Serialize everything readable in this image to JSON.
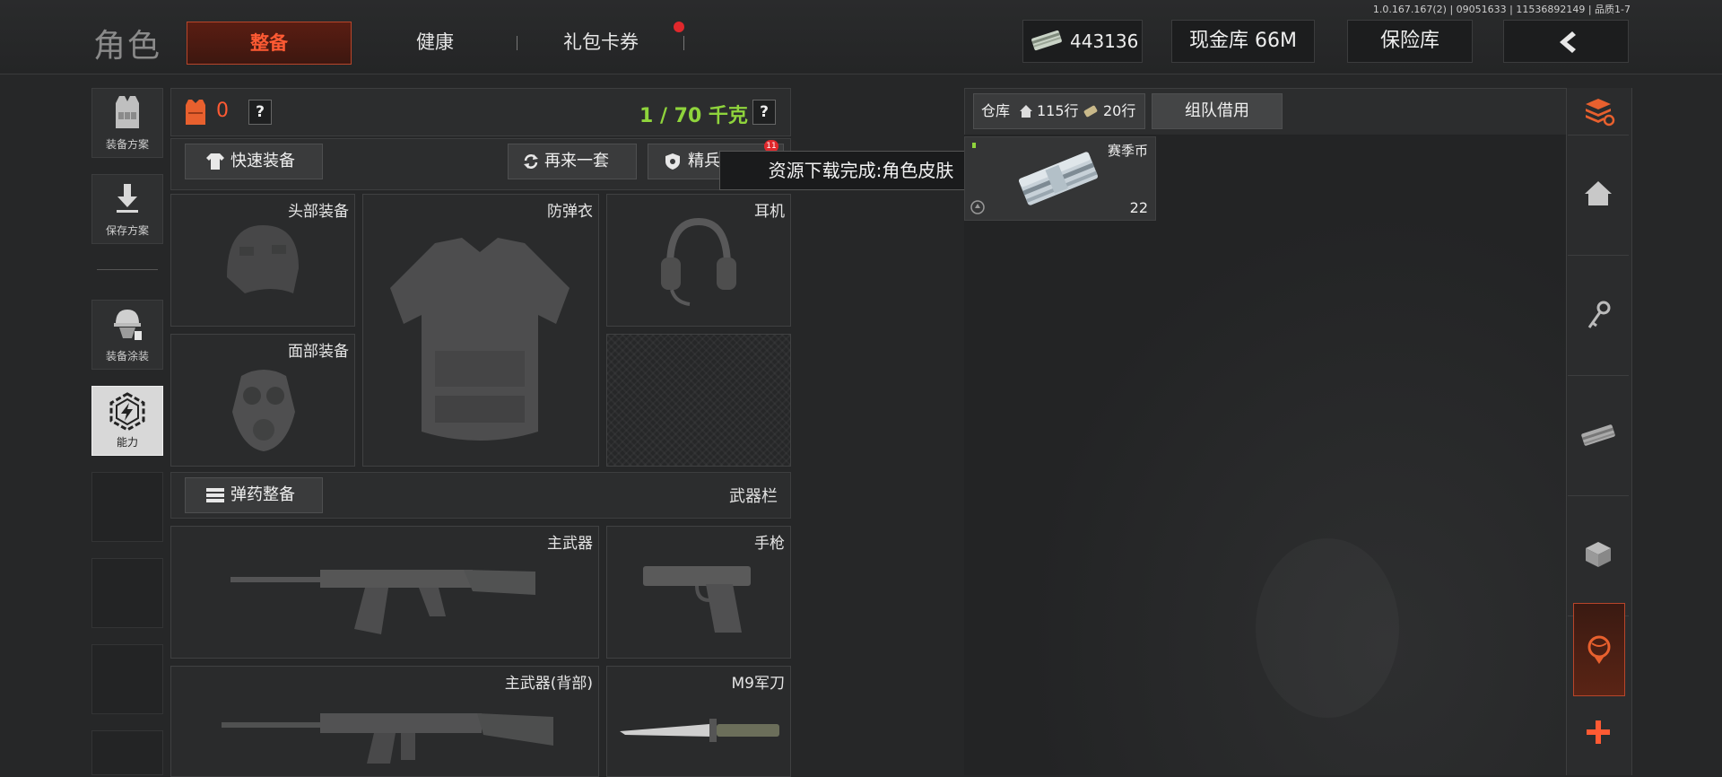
{
  "version": "1.0.167.167(2) | 09051633 | 11536892149 | 品质1-7",
  "header": {
    "title": "角色",
    "tabs": [
      {
        "label": "整备",
        "active": true
      },
      {
        "label": "健康",
        "active": false
      },
      {
        "label": "礼包卡券",
        "active": false,
        "badge": true
      }
    ],
    "currency_value": "443136",
    "cash_storage": "现金库 66M",
    "vault": "保险库"
  },
  "left_nav": {
    "items": [
      {
        "label": "装备方案",
        "icon": "vest-icon"
      },
      {
        "label": "保存方案",
        "icon": "download-icon"
      },
      {
        "label": "装备涂装",
        "icon": "paint-helmet-icon"
      },
      {
        "label": "能力",
        "icon": "ability-hex-icon",
        "selected": true
      }
    ]
  },
  "loadout": {
    "armor_count": "0",
    "help": "?",
    "weight": "1 / 70 千克",
    "quick_equip": "快速装备",
    "repeat_set": "再来一套",
    "elite": "精兵",
    "elite_badge": "11",
    "toast": "资源下载完成:角色皮肤",
    "slots": {
      "head": "头部装备",
      "armor": "防弹衣",
      "headset": "耳机",
      "face": "面部装备"
    },
    "ammo_button": "弹药整备",
    "weapon_bar": "武器栏",
    "weapons": {
      "primary": "主武器",
      "pistol": "手枪",
      "primary_back": "主武器(背部)",
      "knife": "M9军刀"
    }
  },
  "storage": {
    "warehouse_label": "仓库",
    "rows": "115行",
    "extra_rows": "20行",
    "team_borrow": "组队借用",
    "item": {
      "name": "赛季币",
      "count": "22"
    }
  },
  "colors": {
    "accent": "#ff5a33",
    "weight_green": "#8fd43c",
    "badge_red": "#e0282c"
  }
}
